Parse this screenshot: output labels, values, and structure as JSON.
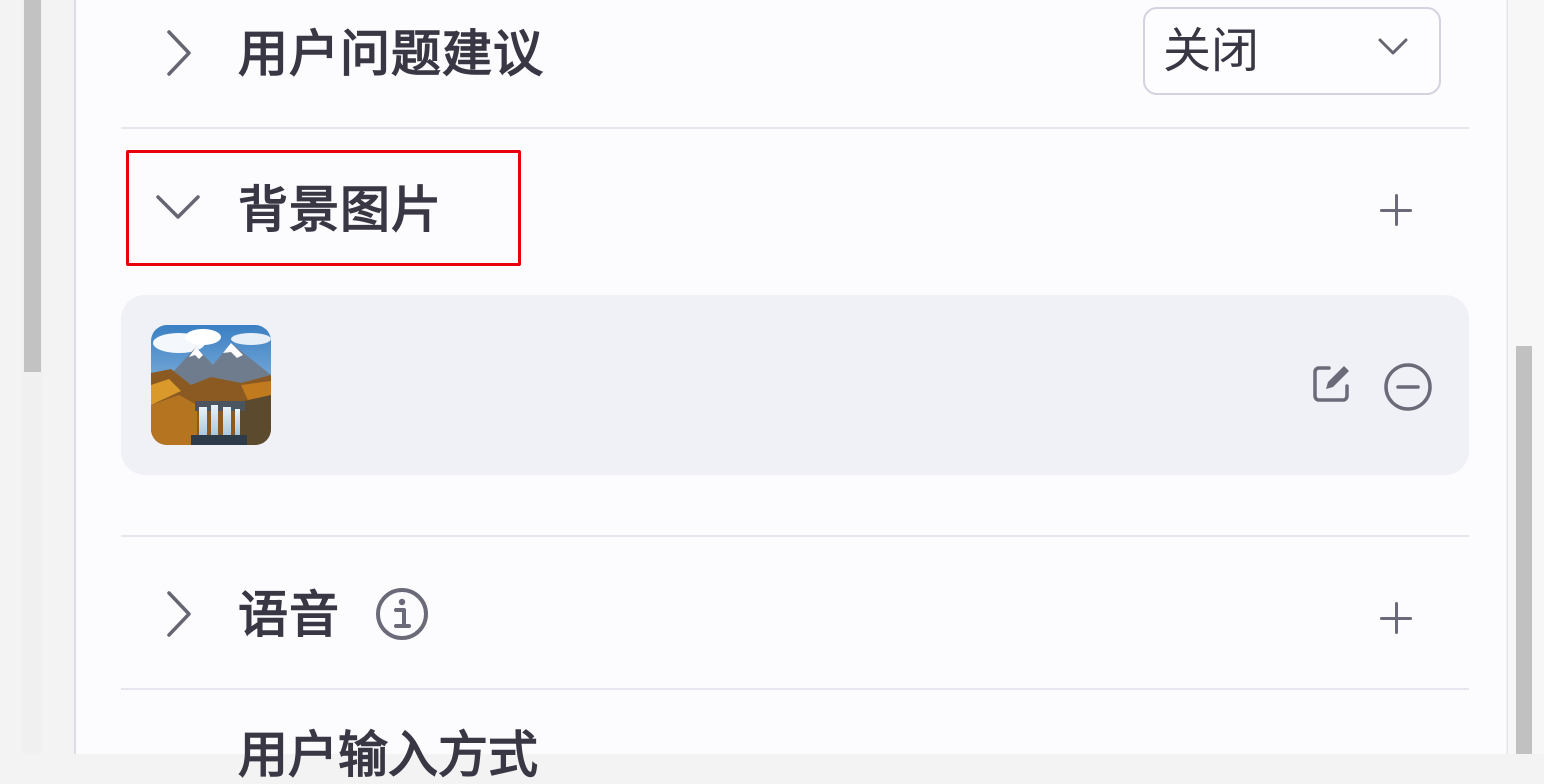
{
  "sections": {
    "user_feedback": {
      "title": "用户问题建议",
      "select_value": "关闭"
    },
    "background_image": {
      "title": "背景图片"
    },
    "voice": {
      "title": "语音"
    },
    "input_mode": {
      "title": "用户输入方式"
    }
  },
  "icons": {
    "collapsed_chevron": "chevron-right-icon",
    "expanded_chevron": "chevron-down-icon",
    "add": "plus-icon",
    "edit": "edit-icon",
    "remove": "minus-circle-icon",
    "info": "info-icon",
    "dropdown": "chevron-down-icon"
  },
  "colors": {
    "highlight": "#e8000b",
    "text": "#383743",
    "icon": "#6a6a78",
    "card_background": "#f0f0f7"
  }
}
